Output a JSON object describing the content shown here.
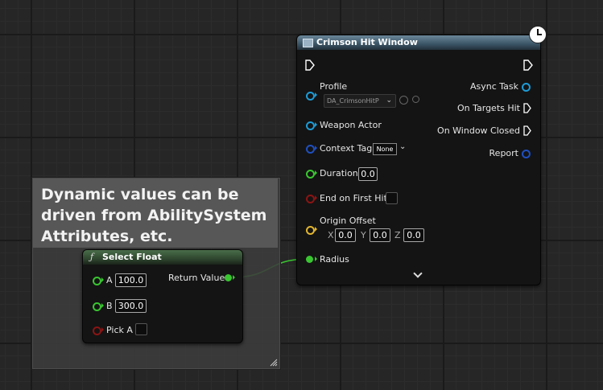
{
  "comment": {
    "text": "Dynamic values can be driven from AbilitySystem Attributes, etc."
  },
  "select_float": {
    "title": "Select Float",
    "pins": {
      "a_label": "A",
      "a_value": "100.0",
      "b_label": "B",
      "b_value": "300.0",
      "pick_label": "Pick A",
      "return_label": "Return Value"
    }
  },
  "crimson_node": {
    "title": "Crimson Hit Window",
    "inputs": {
      "profile_label": "Profile",
      "profile_value": "DA_CrimsonHitP",
      "weapon_label": "Weapon Actor",
      "context_label": "Context Tag",
      "context_value": "None",
      "duration_label": "Duration",
      "duration_value": "0.0",
      "end_label": "End on First Hit",
      "origin_label": "Origin Offset",
      "x_label": "X",
      "x_value": "0.0",
      "y_label": "Y",
      "y_value": "0.0",
      "z_label": "Z",
      "z_value": "0.0",
      "radius_label": "Radius"
    },
    "outputs": {
      "async_label": "Async Task",
      "targets_label": "On Targets Hit",
      "closed_label": "On Window Closed",
      "report_label": "Report"
    }
  },
  "colors": {
    "float_pin": "#39c630",
    "object_pin": "#1d9bd6",
    "struct_pin": "#1f4fbf",
    "bool_pin": "#8b1414",
    "vector_pin": "#e3b630",
    "header_select": "#2f4a2f",
    "header_crimson": "#3b5566"
  }
}
